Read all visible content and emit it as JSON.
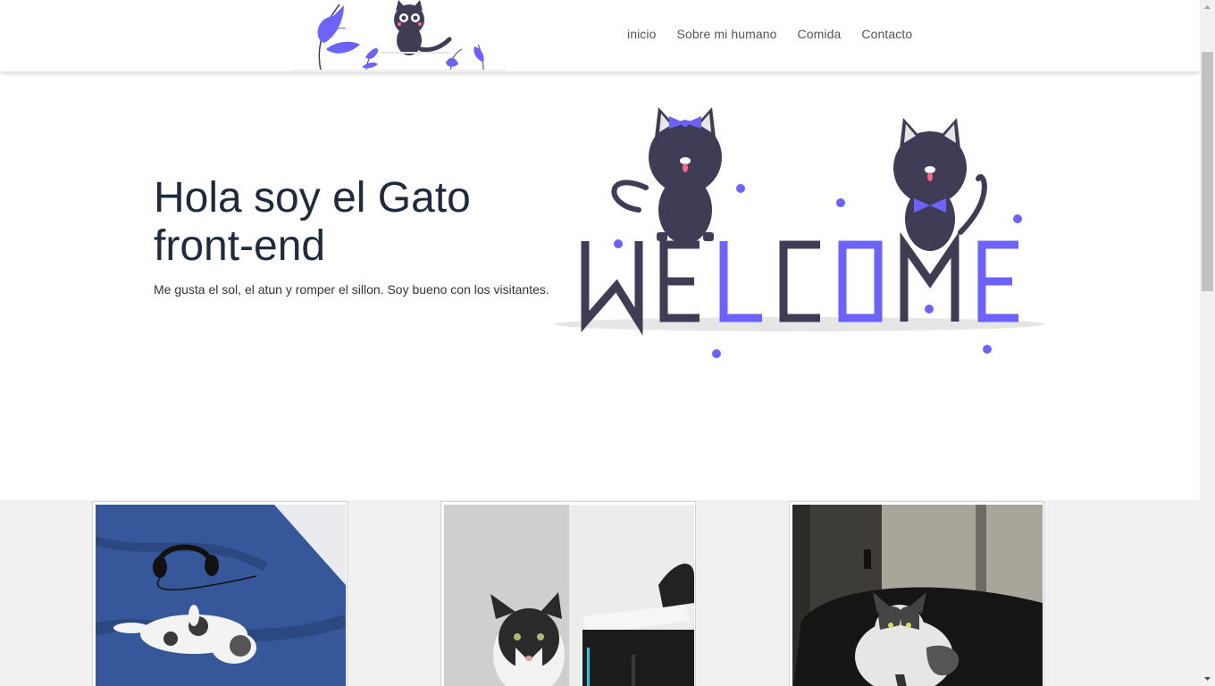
{
  "nav": {
    "items": [
      {
        "label": "inicio"
      },
      {
        "label": "Sobre mi humano"
      },
      {
        "label": "Comida"
      },
      {
        "label": "Contacto"
      }
    ]
  },
  "hero": {
    "title": "Hola soy el Gato front-end",
    "subtitle": "Me gusta el sol, el atun y romper el sillon. Soy bueno con los visitantes.",
    "illustration_text": [
      "W",
      "E",
      "L",
      "C",
      "O",
      "M",
      "E"
    ]
  },
  "colors": {
    "accent": "#6c63ff",
    "dark": "#3f3d56",
    "title": "#1f2a3c",
    "gallery_bg": "#f0f0f0"
  },
  "gallery": {
    "photos": [
      {
        "icon": "cat-on-blue-bed-photo"
      },
      {
        "icon": "cat-by-desk-photo"
      },
      {
        "icon": "cat-on-black-sofa-photo"
      }
    ]
  }
}
